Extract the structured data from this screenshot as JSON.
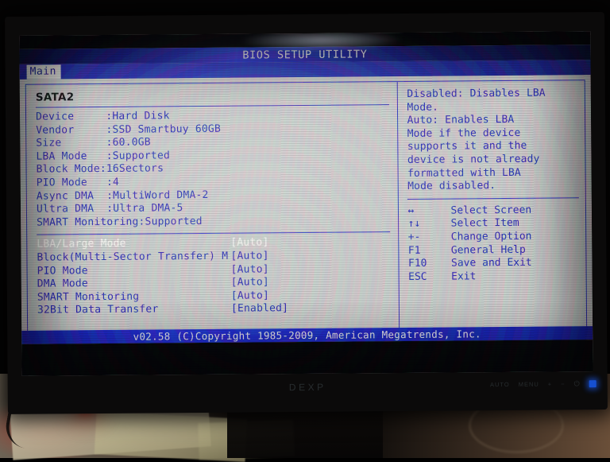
{
  "screen": {
    "title": "BIOS SETUP UTILITY",
    "active_tab": "Main",
    "footer": "v02.58 (C)Copyright 1985-2009, American Megatrends, Inc."
  },
  "drive": {
    "group_name": "SATA2",
    "info": [
      "Device     :Hard Disk",
      "Vendor     :SSD Smartbuy 60GB",
      "Size       :60.0GB",
      "LBA Mode   :Supported",
      "Block Mode:16Sectors",
      "PIO Mode   :4",
      "Async DMA  :MultiWord DMA-2",
      "Ultra DMA  :Ultra DMA-5",
      "SMART Monitoring:Supported"
    ]
  },
  "options": [
    {
      "label": "LBA/Large Mode",
      "value": "[Auto]",
      "selected": true
    },
    {
      "label": "Block(Multi-Sector Transfer) M",
      "value": "[Auto]",
      "selected": false
    },
    {
      "label": "PIO Mode",
      "value": "[Auto]",
      "selected": false
    },
    {
      "label": "DMA Mode",
      "value": "[Auto]",
      "selected": false
    },
    {
      "label": "SMART Monitoring",
      "value": "[Auto]",
      "selected": false
    },
    {
      "label": "32Bit Data Transfer",
      "value": "[Enabled]",
      "selected": false
    }
  ],
  "help": {
    "lines": [
      "Disabled: Disables LBA",
      "Mode.",
      "Auto: Enables LBA",
      "Mode if the device",
      "supports it and the",
      "device is not already",
      "formatted with LBA",
      "Mode disabled."
    ]
  },
  "legend": [
    {
      "key": "↔",
      "desc": "Select Screen"
    },
    {
      "key": "↑↓",
      "desc": "Select Item"
    },
    {
      "key": "+-",
      "desc": "Change Option"
    },
    {
      "key": "F1",
      "desc": "General Help"
    },
    {
      "key": "F10",
      "desc": "Save and Exit"
    },
    {
      "key": "ESC",
      "desc": "Exit"
    }
  ],
  "monitor": {
    "brand": "DEXP",
    "buttons": [
      "AUTO",
      "MENU",
      "+",
      "−",
      "⏻"
    ]
  },
  "colors": {
    "bios_background": "#c3c3c0",
    "bios_text": "#2222a8",
    "title_bar": "#2a33cf",
    "highlight_text": "#efefe8",
    "group_label": "#111111"
  }
}
